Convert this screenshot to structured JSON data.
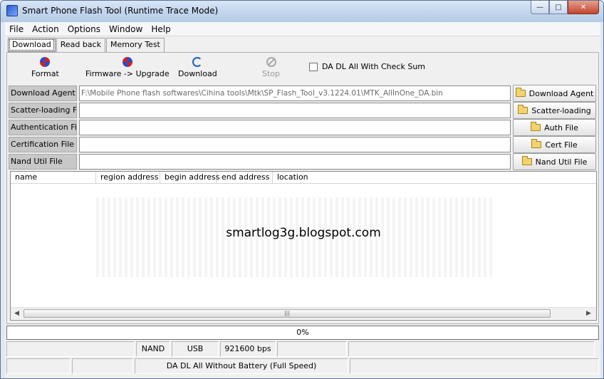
{
  "window": {
    "title": "Smart Phone Flash Tool (Runtime Trace Mode)"
  },
  "menubar": {
    "items": [
      "File",
      "Action",
      "Options",
      "Window",
      "Help"
    ]
  },
  "tabs": [
    "Download",
    "Read back",
    "Memory Test"
  ],
  "toolbar": {
    "format": "Format",
    "firmware_upgrade": "Firmware -> Upgrade",
    "download": "Download",
    "stop": "Stop",
    "checksum_label": "DA DL All With Check Sum",
    "checksum_checked": false
  },
  "files": {
    "download_agent": {
      "label": "Download Agent",
      "value": "F:\\Mobile Phone flash softwares\\Cihina tools\\Mtk\\SP_Flash_Tool_v3.1224.01\\MTK_AllInOne_DA.bin",
      "button": "Download Agent"
    },
    "scatter": {
      "label": "Scatter-loading File",
      "value": "",
      "button": "Scatter-loading"
    },
    "auth": {
      "label": "Authentication File",
      "value": "",
      "button": "Auth File"
    },
    "cert": {
      "label": "Certification File",
      "value": "",
      "button": "Cert File"
    },
    "nand": {
      "label": "Nand Util File",
      "value": "",
      "button": "Nand Util File"
    }
  },
  "table": {
    "columns": [
      "name",
      "region address",
      "begin address",
      "end address",
      "location"
    ],
    "rows": []
  },
  "watermark": "smartlog3g.blogspot.com",
  "progress": {
    "text": "0%",
    "value": 0
  },
  "status": {
    "storage": "NAND",
    "port": "USB",
    "baud": "921600 bps",
    "mode": "DA DL All Without Battery (Full Speed)"
  }
}
